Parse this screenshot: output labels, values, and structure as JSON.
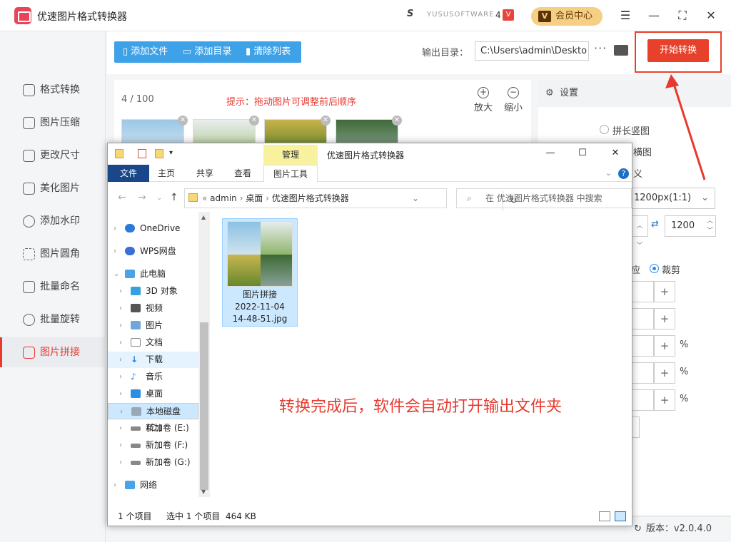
{
  "app": {
    "title": "优速图片格式转换器",
    "brand_text": "YUSUSOFTWARE",
    "brand_version": "4",
    "vip_label": "会员中心",
    "vip_badge": "V"
  },
  "sidebar": {
    "items": [
      {
        "label": "格式转换",
        "icon": "convert-icon"
      },
      {
        "label": "图片压缩",
        "icon": "compress-icon"
      },
      {
        "label": "更改尺寸",
        "icon": "resize-icon"
      },
      {
        "label": "美化图片",
        "icon": "beautify-icon"
      },
      {
        "label": "添加水印",
        "icon": "watermark-icon"
      },
      {
        "label": "图片圆角",
        "icon": "round-corner-icon"
      },
      {
        "label": "批量命名",
        "icon": "rename-icon"
      },
      {
        "label": "批量旋转",
        "icon": "rotate-icon"
      },
      {
        "label": "图片拼接",
        "icon": "stitch-icon"
      }
    ],
    "active": "图片拼接"
  },
  "toolbar": {
    "add_file": "添加文件",
    "add_folder": "添加目录",
    "clear_list": "清除列表",
    "output_label": "输出目录：",
    "output_path": "C:\\Users\\admin\\Deskto",
    "more": "···",
    "start_button": "开始转换"
  },
  "list": {
    "count": "4 / 100",
    "tip": "提示：拖动图片可调整前后顺序",
    "zoom_in": "放大",
    "zoom_out": "缩小"
  },
  "settings": {
    "header": "设置",
    "option_vertical": "拼长竖图",
    "option_horizontal_partial": "横图",
    "option_custom_partial": "义",
    "size_select": "1200px(1:1)",
    "size_value": "1200",
    "fit_partial": "应",
    "crop_label": "裁剪",
    "percent": "%"
  },
  "explorer": {
    "manage_tab": "管理",
    "title": "优速图片格式转换器",
    "tabs": [
      "文件",
      "主页",
      "共享",
      "查看",
      "图片工具"
    ],
    "address": [
      "admin",
      "桌面",
      "优速图片格式转换器"
    ],
    "search_placeholder": "在 优速图片格式转换器 中搜索",
    "tree": [
      "OneDrive",
      "WPS网盘",
      "此电脑",
      "3D 对象",
      "视频",
      "图片",
      "文档",
      "下载",
      "音乐",
      "桌面",
      "本地磁盘 (C:)",
      "新加卷 (E:)",
      "新加卷 (F:)",
      "新加卷 (G:)",
      "网络"
    ],
    "file_name": "图片拼接 2022-11-04 14-48-51.jpg",
    "file_name_lines": [
      "图片拼接",
      "2022-11-04",
      "14-48-51.jpg"
    ],
    "status_items": "1 个项目",
    "status_selected": "选中 1 个项目",
    "status_size": "464 KB"
  },
  "message": "转换完成后，软件会自动打开输出文件夹",
  "footer": {
    "version_label": "版本：v2.0.4.0"
  },
  "colors": {
    "accent_red": "#e8392e",
    "toolbar_blue": "#3ea2e8",
    "start_button": "#e8412b",
    "vip_gold": "#f5cf84"
  }
}
